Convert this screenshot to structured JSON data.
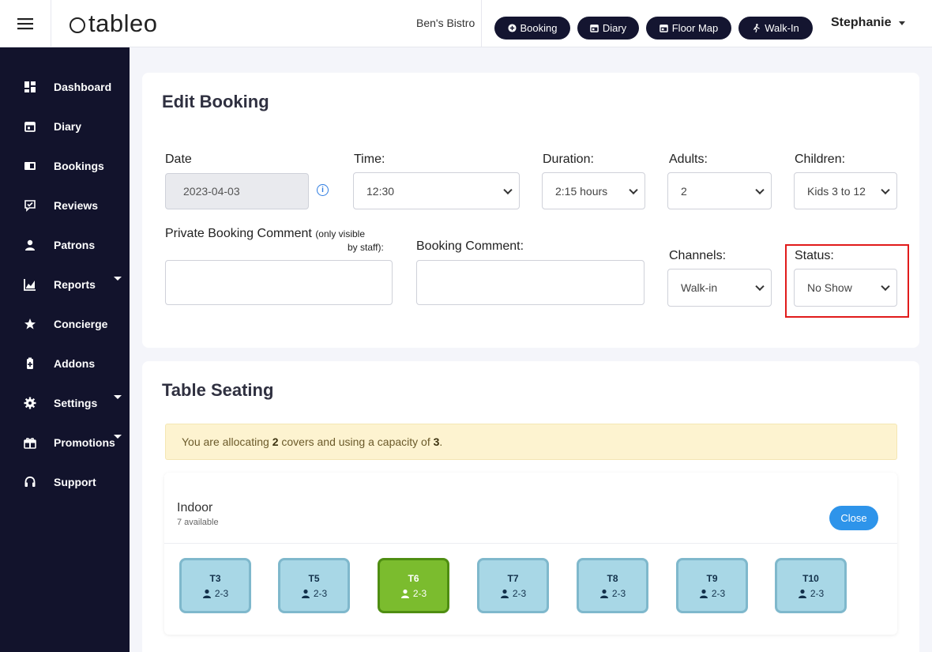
{
  "header": {
    "logo": "tableo",
    "venue": "Ben's Bistro",
    "buttons": [
      {
        "label": "Booking",
        "icon": "plus-circle-icon"
      },
      {
        "label": "Diary",
        "icon": "calendar-icon"
      },
      {
        "label": "Floor Map",
        "icon": "calendar-icon"
      },
      {
        "label": "Walk-In",
        "icon": "walking-person-icon"
      }
    ],
    "user": "Stephanie"
  },
  "sidebar": {
    "items": [
      {
        "label": "Dashboard",
        "icon": "dashboard-icon"
      },
      {
        "label": "Diary",
        "icon": "calendar-icon"
      },
      {
        "label": "Bookings",
        "icon": "book-icon"
      },
      {
        "label": "Reviews",
        "icon": "review-icon"
      },
      {
        "label": "Patrons",
        "icon": "user-icon"
      },
      {
        "label": "Reports",
        "icon": "chart-icon",
        "has_submenu": true
      },
      {
        "label": "Concierge",
        "icon": "star-icon"
      },
      {
        "label": "Addons",
        "icon": "addon-icon"
      },
      {
        "label": "Settings",
        "icon": "gear-icon",
        "has_submenu": true
      },
      {
        "label": "Promotions",
        "icon": "gift-icon",
        "has_submenu": true
      },
      {
        "label": "Support",
        "icon": "headset-icon"
      }
    ]
  },
  "edit_booking": {
    "title": "Edit Booking",
    "date_label": "Date",
    "date_value": "2023-04-03",
    "time_label": "Time:",
    "time_value": "12:30",
    "duration_label": "Duration:",
    "duration_value": "2:15 hours",
    "adults_label": "Adults:",
    "adults_value": "2",
    "children_label": "Children:",
    "children_value": "Kids 3 to 12",
    "private_comment_label": "Private Booking Comment",
    "private_comment_note_1": "(only visible",
    "private_comment_note_2": "by staff):",
    "booking_comment_label": "Booking Comment:",
    "channels_label": "Channels:",
    "channels_value": "Walk-in",
    "status_label": "Status:",
    "status_value": "No Show"
  },
  "table_seating": {
    "title": "Table Seating",
    "alert_prefix": "You are allocating ",
    "covers": "2",
    "alert_middle": " covers and using a capacity of ",
    "capacity": "3",
    "alert_suffix": ".",
    "area_name": "Indoor",
    "area_available": "7 available",
    "close_label": "Close",
    "tables": [
      {
        "name": "T3",
        "capacity": "2-3",
        "selected": false
      },
      {
        "name": "T5",
        "capacity": "2-3",
        "selected": false
      },
      {
        "name": "T6",
        "capacity": "2-3",
        "selected": true
      },
      {
        "name": "T7",
        "capacity": "2-3",
        "selected": false
      },
      {
        "name": "T8",
        "capacity": "2-3",
        "selected": false
      },
      {
        "name": "T9",
        "capacity": "2-3",
        "selected": false
      },
      {
        "name": "T10",
        "capacity": "2-3",
        "selected": false
      }
    ]
  },
  "colors": {
    "sidebar_bg": "#12132c",
    "pill_bg": "#141530",
    "accent_blue": "#2e94ea",
    "table_available": "#a8d7e6",
    "table_selected": "#7bbc2e",
    "highlight_red": "#e11b1b"
  }
}
